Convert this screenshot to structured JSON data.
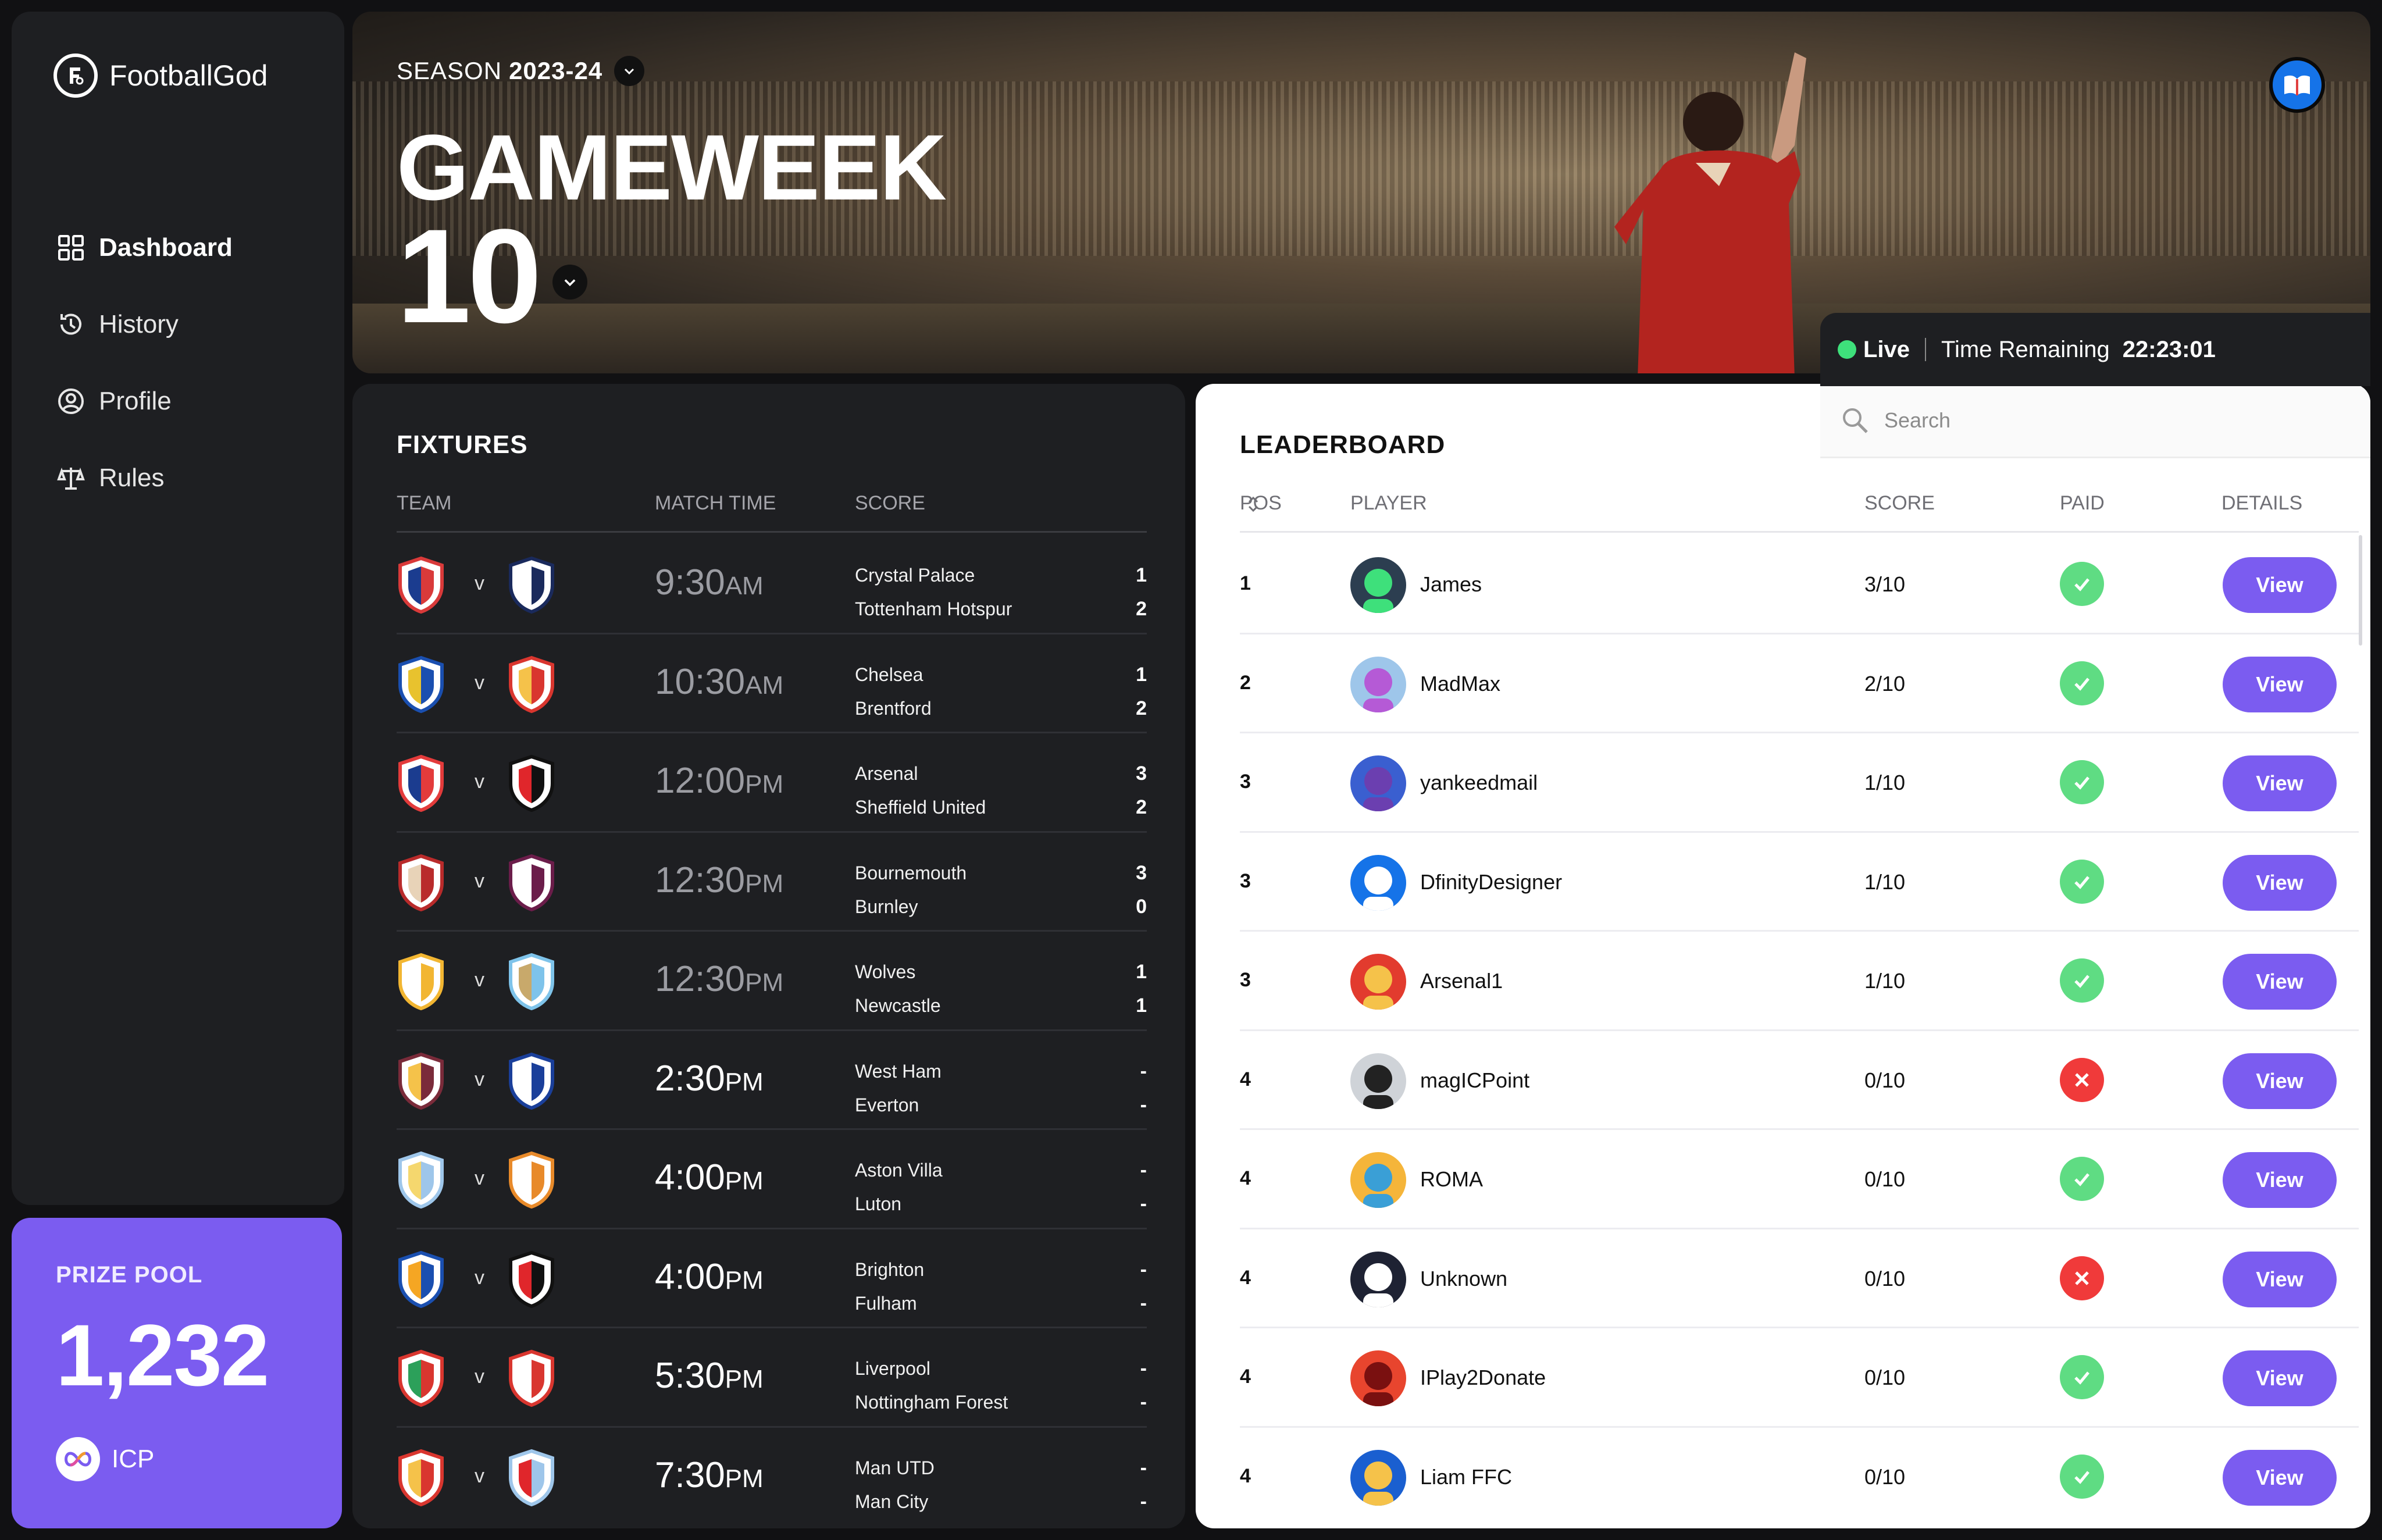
{
  "app": {
    "name": "FootballGod"
  },
  "sidebar": {
    "items": [
      {
        "label": "Dashboard",
        "icon": "dashboard-grid-icon",
        "active": true
      },
      {
        "label": "History",
        "icon": "history-icon",
        "active": false
      },
      {
        "label": "Profile",
        "icon": "profile-icon",
        "active": false
      },
      {
        "label": "Rules",
        "icon": "scales-icon",
        "active": false
      }
    ]
  },
  "prize_pool": {
    "label": "PRIZE POOL",
    "value": "1,232",
    "currency": "ICP"
  },
  "hero": {
    "season_label": "SEASON",
    "season_value": "2023-24",
    "gameweek_label": "GAMEWEEK",
    "gameweek_number": "10"
  },
  "live": {
    "status": "Live",
    "time_label": "Time Remaining",
    "time_value": "22:23:01"
  },
  "fixtures": {
    "title": "FIXTURES",
    "headers": {
      "team": "TEAM",
      "time": "MATCH TIME",
      "score": "SCORE"
    },
    "vs_label": "v",
    "rows": [
      {
        "time": "9:30",
        "ampm": "AM",
        "home": "Crystal Palace",
        "away": "Tottenham Hotspur",
        "home_score": "1",
        "away_score": "2",
        "played": true,
        "home_colors": [
          "#d93a3a",
          "#1b3c8f"
        ],
        "away_colors": [
          "#1a2a5c",
          "#ffffff"
        ]
      },
      {
        "time": "10:30",
        "ampm": "AM",
        "home": "Chelsea",
        "away": "Brentford",
        "home_score": "1",
        "away_score": "2",
        "played": true,
        "home_colors": [
          "#1a4fb0",
          "#e8c22e"
        ],
        "away_colors": [
          "#d9362f",
          "#f5c24a"
        ]
      },
      {
        "time": "12:00",
        "ampm": "PM",
        "home": "Arsenal",
        "away": "Sheffield United",
        "home_score": "3",
        "away_score": "2",
        "played": true,
        "home_colors": [
          "#e33b3b",
          "#1b3c8f"
        ],
        "away_colors": [
          "#111111",
          "#e0262b"
        ]
      },
      {
        "time": "12:30",
        "ampm": "PM",
        "home": "Bournemouth",
        "away": "Burnley",
        "home_score": "3",
        "away_score": "0",
        "played": true,
        "home_colors": [
          "#b92b2b",
          "#e8d3b8"
        ],
        "away_colors": [
          "#6b1d4a",
          "#ffffff"
        ]
      },
      {
        "time": "12:30",
        "ampm": "PM",
        "home": "Wolves",
        "away": "Newcastle",
        "home_score": "1",
        "away_score": "1",
        "played": true,
        "home_colors": [
          "#f2b632",
          "#ffffff"
        ],
        "away_colors": [
          "#7ec3ea",
          "#c8a96b"
        ]
      },
      {
        "time": "2:30",
        "ampm": "PM",
        "home": "West Ham",
        "away": "Everton",
        "home_score": "-",
        "away_score": "-",
        "played": false,
        "home_colors": [
          "#7a2b3a",
          "#f5c24a"
        ],
        "away_colors": [
          "#1a3f9a",
          "#ffffff"
        ]
      },
      {
        "time": "4:00",
        "ampm": "PM",
        "home": "Aston Villa",
        "away": "Luton",
        "home_score": "-",
        "away_score": "-",
        "played": false,
        "home_colors": [
          "#9ec6ea",
          "#f5d76e"
        ],
        "away_colors": [
          "#e88a2a",
          "#ffffff"
        ]
      },
      {
        "time": "4:00",
        "ampm": "PM",
        "home": "Brighton",
        "away": "Fulham",
        "home_score": "-",
        "away_score": "-",
        "played": false,
        "home_colors": [
          "#1a4fb0",
          "#f5a623"
        ],
        "away_colors": [
          "#111111",
          "#e0262b"
        ]
      },
      {
        "time": "5:30",
        "ampm": "PM",
        "home": "Liverpool",
        "away": "Nottingham Forest",
        "home_score": "-",
        "away_score": "-",
        "played": false,
        "home_colors": [
          "#d9362f",
          "#2ca05a"
        ],
        "away_colors": [
          "#d9362f",
          "#ffffff"
        ]
      },
      {
        "time": "7:30",
        "ampm": "PM",
        "home": "Man UTD",
        "away": "Man City",
        "home_score": "-",
        "away_score": "-",
        "played": false,
        "home_colors": [
          "#d9362f",
          "#f5c24a"
        ],
        "away_colors": [
          "#9ec6ea",
          "#e0262b"
        ]
      }
    ]
  },
  "leaderboard": {
    "title": "LEADERBOARD",
    "search_placeholder": "Search",
    "headers": {
      "pos": "POS",
      "player": "PLAYER",
      "score": "SCORE",
      "paid": "PAID",
      "details": "DETAILS"
    },
    "view_label": "View",
    "rows": [
      {
        "pos": "1",
        "name": "James",
        "score": "3/10",
        "paid": true,
        "avatar_bg": "#2c3e50",
        "avatar_fg": "#3ee07b"
      },
      {
        "pos": "2",
        "name": "MadMax",
        "score": "2/10",
        "paid": true,
        "avatar_bg": "#9ec6ea",
        "avatar_fg": "#b55ad6"
      },
      {
        "pos": "3",
        "name": "yankeedmail",
        "score": "1/10",
        "paid": true,
        "avatar_bg": "#3a5fd0",
        "avatar_fg": "#6b3fb0"
      },
      {
        "pos": "3",
        "name": "DfinityDesigner",
        "score": "1/10",
        "paid": true,
        "avatar_bg": "#1573e8",
        "avatar_fg": "#ffffff"
      },
      {
        "pos": "3",
        "name": "Arsenal1",
        "score": "1/10",
        "paid": true,
        "avatar_bg": "#e23b2e",
        "avatar_fg": "#f5c24a"
      },
      {
        "pos": "4",
        "name": "magICPoint",
        "score": "0/10",
        "paid": false,
        "avatar_bg": "#cfd3d8",
        "avatar_fg": "#222222"
      },
      {
        "pos": "4",
        "name": "ROMA",
        "score": "0/10",
        "paid": true,
        "avatar_bg": "#f5b53a",
        "avatar_fg": "#3a9fd6"
      },
      {
        "pos": "4",
        "name": "Unknown",
        "score": "0/10",
        "paid": false,
        "avatar_bg": "#1e2233",
        "avatar_fg": "#ffffff"
      },
      {
        "pos": "4",
        "name": "IPlay2Donate",
        "score": "0/10",
        "paid": true,
        "avatar_bg": "#e8452e",
        "avatar_fg": "#7a1010"
      },
      {
        "pos": "4",
        "name": "Liam FFC",
        "score": "0/10",
        "paid": true,
        "avatar_bg": "#1a5fd0",
        "avatar_fg": "#f5c24a"
      }
    ]
  }
}
